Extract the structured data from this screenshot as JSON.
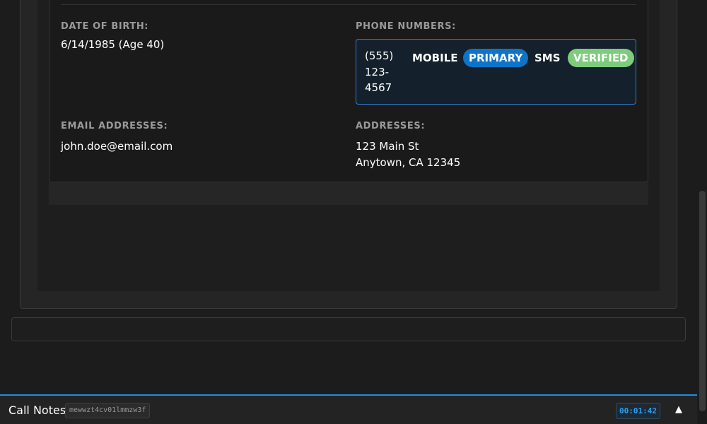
{
  "contact_details": {
    "date_of_birth": {
      "label": "DATE OF BIRTH:",
      "value": "6/14/1985 (Age 40)"
    },
    "phone_numbers": {
      "label": "PHONE NUMBERS:",
      "items": [
        {
          "number_lines": [
            "(555)",
            "123-",
            "4567"
          ],
          "type": "MOBILE",
          "primary_badge": "PRIMARY",
          "sms": "SMS",
          "verified_badge": "VERIFIED"
        }
      ]
    },
    "email_addresses": {
      "label": "EMAIL ADDRESSES:",
      "items": [
        "john.doe@email.com"
      ]
    },
    "addresses": {
      "label": "ADDRESSES:",
      "lines": [
        "123 Main St",
        "Anytown, CA 12345"
      ]
    }
  },
  "call_notes_bar": {
    "title": "Call Notes",
    "session_id": "mewwzt4cv01lmmzw3f",
    "timer": "00:01:42",
    "toggle_icon": "caret-up-icon"
  },
  "colors": {
    "accent_blue": "#1f8ce6",
    "primary_badge": "#0e74c8",
    "verified_badge": "#7ccc7c",
    "background": "#1c1c1c"
  }
}
